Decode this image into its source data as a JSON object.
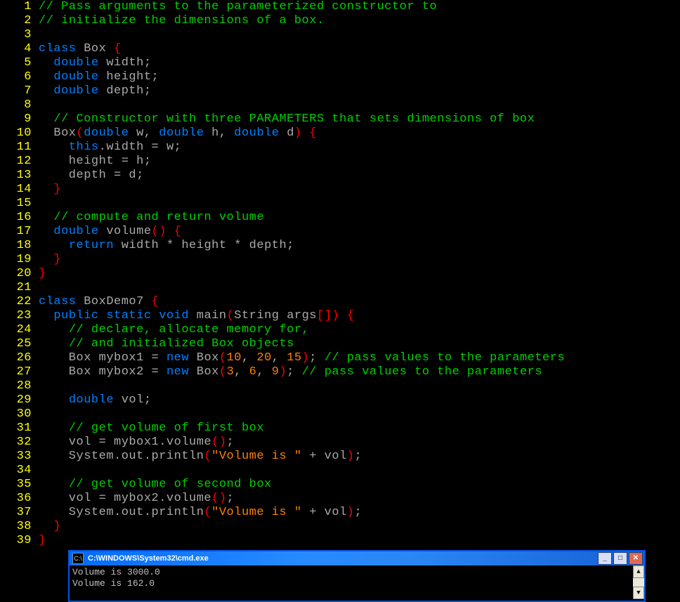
{
  "lines": [
    {
      "n": "1",
      "tokens": [
        {
          "c": "c",
          "t": "// Pass arguments to the parameterized constructor to"
        }
      ]
    },
    {
      "n": "2",
      "tokens": [
        {
          "c": "c",
          "t": "// initialize the dimensions of a box."
        }
      ]
    },
    {
      "n": "3",
      "tokens": []
    },
    {
      "n": "4",
      "tokens": [
        {
          "c": "kw",
          "t": "class"
        },
        {
          "c": "t",
          "t": " Box "
        },
        {
          "c": "br",
          "t": "{"
        }
      ]
    },
    {
      "n": "5",
      "tokens": [
        {
          "c": "t",
          "t": "  "
        },
        {
          "c": "kw",
          "t": "double"
        },
        {
          "c": "t",
          "t": " width;"
        }
      ]
    },
    {
      "n": "6",
      "tokens": [
        {
          "c": "t",
          "t": "  "
        },
        {
          "c": "kw",
          "t": "double"
        },
        {
          "c": "t",
          "t": " height;"
        }
      ]
    },
    {
      "n": "7",
      "tokens": [
        {
          "c": "t",
          "t": "  "
        },
        {
          "c": "kw",
          "t": "double"
        },
        {
          "c": "t",
          "t": " depth;"
        }
      ]
    },
    {
      "n": "8",
      "tokens": []
    },
    {
      "n": "9",
      "tokens": [
        {
          "c": "t",
          "t": "  "
        },
        {
          "c": "c",
          "t": "// Constructor with three PARAMETERS that sets dimensions of box"
        }
      ]
    },
    {
      "n": "10",
      "tokens": [
        {
          "c": "t",
          "t": "  Box"
        },
        {
          "c": "br",
          "t": "("
        },
        {
          "c": "kw",
          "t": "double"
        },
        {
          "c": "t",
          "t": " w, "
        },
        {
          "c": "kw",
          "t": "double"
        },
        {
          "c": "t",
          "t": " h, "
        },
        {
          "c": "kw",
          "t": "double"
        },
        {
          "c": "t",
          "t": " d"
        },
        {
          "c": "br",
          "t": ")"
        },
        {
          "c": "t",
          "t": " "
        },
        {
          "c": "br",
          "t": "{"
        }
      ]
    },
    {
      "n": "11",
      "tokens": [
        {
          "c": "t",
          "t": "    "
        },
        {
          "c": "kw",
          "t": "this"
        },
        {
          "c": "t",
          "t": ".width = w;"
        }
      ]
    },
    {
      "n": "12",
      "tokens": [
        {
          "c": "t",
          "t": "    height = h;"
        }
      ]
    },
    {
      "n": "13",
      "tokens": [
        {
          "c": "t",
          "t": "    depth = d;"
        }
      ]
    },
    {
      "n": "14",
      "tokens": [
        {
          "c": "t",
          "t": "  "
        },
        {
          "c": "br",
          "t": "}"
        }
      ]
    },
    {
      "n": "15",
      "tokens": []
    },
    {
      "n": "16",
      "tokens": [
        {
          "c": "t",
          "t": "  "
        },
        {
          "c": "c",
          "t": "// compute and return volume"
        }
      ]
    },
    {
      "n": "17",
      "tokens": [
        {
          "c": "t",
          "t": "  "
        },
        {
          "c": "kw",
          "t": "double"
        },
        {
          "c": "t",
          "t": " volume"
        },
        {
          "c": "br",
          "t": "()"
        },
        {
          "c": "t",
          "t": " "
        },
        {
          "c": "br",
          "t": "{"
        }
      ]
    },
    {
      "n": "18",
      "tokens": [
        {
          "c": "t",
          "t": "    "
        },
        {
          "c": "kw",
          "t": "return"
        },
        {
          "c": "t",
          "t": " width * height * depth;"
        }
      ]
    },
    {
      "n": "19",
      "tokens": [
        {
          "c": "t",
          "t": "  "
        },
        {
          "c": "br",
          "t": "}"
        }
      ]
    },
    {
      "n": "20",
      "tokens": [
        {
          "c": "br",
          "t": "}"
        }
      ]
    },
    {
      "n": "21",
      "tokens": []
    },
    {
      "n": "22",
      "tokens": [
        {
          "c": "kw",
          "t": "class"
        },
        {
          "c": "t",
          "t": " BoxDemo7 "
        },
        {
          "c": "br",
          "t": "{"
        }
      ]
    },
    {
      "n": "23",
      "tokens": [
        {
          "c": "t",
          "t": "  "
        },
        {
          "c": "kw",
          "t": "public"
        },
        {
          "c": "t",
          "t": " "
        },
        {
          "c": "kw",
          "t": "static"
        },
        {
          "c": "t",
          "t": " "
        },
        {
          "c": "kw",
          "t": "void"
        },
        {
          "c": "t",
          "t": " main"
        },
        {
          "c": "br",
          "t": "("
        },
        {
          "c": "t",
          "t": "String args"
        },
        {
          "c": "br",
          "t": "[])"
        },
        {
          "c": "t",
          "t": " "
        },
        {
          "c": "br",
          "t": "{"
        }
      ]
    },
    {
      "n": "24",
      "tokens": [
        {
          "c": "t",
          "t": "    "
        },
        {
          "c": "c",
          "t": "// declare, allocate memory for,"
        }
      ]
    },
    {
      "n": "25",
      "tokens": [
        {
          "c": "t",
          "t": "    "
        },
        {
          "c": "c",
          "t": "// and initialized Box objects"
        }
      ]
    },
    {
      "n": "26",
      "tokens": [
        {
          "c": "t",
          "t": "    Box mybox1 = "
        },
        {
          "c": "kw",
          "t": "new"
        },
        {
          "c": "t",
          "t": " Box"
        },
        {
          "c": "br",
          "t": "("
        },
        {
          "c": "nu",
          "t": "10"
        },
        {
          "c": "t",
          "t": ", "
        },
        {
          "c": "nu",
          "t": "20"
        },
        {
          "c": "t",
          "t": ", "
        },
        {
          "c": "nu",
          "t": "15"
        },
        {
          "c": "br",
          "t": ")"
        },
        {
          "c": "t",
          "t": "; "
        },
        {
          "c": "c",
          "t": "// pass values to the parameters"
        }
      ]
    },
    {
      "n": "27",
      "tokens": [
        {
          "c": "t",
          "t": "    Box mybox2 = "
        },
        {
          "c": "kw",
          "t": "new"
        },
        {
          "c": "t",
          "t": " Box"
        },
        {
          "c": "br",
          "t": "("
        },
        {
          "c": "nu",
          "t": "3"
        },
        {
          "c": "t",
          "t": ", "
        },
        {
          "c": "nu",
          "t": "6"
        },
        {
          "c": "t",
          "t": ", "
        },
        {
          "c": "nu",
          "t": "9"
        },
        {
          "c": "br",
          "t": ")"
        },
        {
          "c": "t",
          "t": "; "
        },
        {
          "c": "c",
          "t": "// pass values to the parameters"
        }
      ]
    },
    {
      "n": "28",
      "tokens": []
    },
    {
      "n": "29",
      "tokens": [
        {
          "c": "t",
          "t": "    "
        },
        {
          "c": "kw",
          "t": "double"
        },
        {
          "c": "t",
          "t": " vol;"
        }
      ]
    },
    {
      "n": "30",
      "tokens": []
    },
    {
      "n": "31",
      "tokens": [
        {
          "c": "t",
          "t": "    "
        },
        {
          "c": "c",
          "t": "// get volume of first box"
        }
      ]
    },
    {
      "n": "32",
      "tokens": [
        {
          "c": "t",
          "t": "    vol = mybox1.volume"
        },
        {
          "c": "br",
          "t": "()"
        },
        {
          "c": "t",
          "t": ";"
        }
      ]
    },
    {
      "n": "33",
      "tokens": [
        {
          "c": "t",
          "t": "    System.out.println"
        },
        {
          "c": "br",
          "t": "("
        },
        {
          "c": "st",
          "t": "\"Volume is \""
        },
        {
          "c": "t",
          "t": " + vol"
        },
        {
          "c": "br",
          "t": ")"
        },
        {
          "c": "t",
          "t": ";"
        }
      ]
    },
    {
      "n": "34",
      "tokens": []
    },
    {
      "n": "35",
      "tokens": [
        {
          "c": "t",
          "t": "    "
        },
        {
          "c": "c",
          "t": "// get volume of second box"
        }
      ]
    },
    {
      "n": "36",
      "tokens": [
        {
          "c": "t",
          "t": "    vol = mybox2.volume"
        },
        {
          "c": "br",
          "t": "()"
        },
        {
          "c": "t",
          "t": ";"
        }
      ]
    },
    {
      "n": "37",
      "tokens": [
        {
          "c": "t",
          "t": "    System.out.println"
        },
        {
          "c": "br",
          "t": "("
        },
        {
          "c": "st",
          "t": "\"Volume is \""
        },
        {
          "c": "t",
          "t": " + vol"
        },
        {
          "c": "br",
          "t": ")"
        },
        {
          "c": "t",
          "t": ";"
        }
      ]
    },
    {
      "n": "38",
      "tokens": [
        {
          "c": "t",
          "t": "  "
        },
        {
          "c": "br",
          "t": "}"
        }
      ]
    },
    {
      "n": "39",
      "tokens": [
        {
          "c": "br",
          "t": "}"
        }
      ]
    }
  ],
  "cmd": {
    "icon_text": "C:\\",
    "title": "C:\\WINDOWS\\System32\\cmd.exe",
    "output_lines": [
      "Volume is 3000.0",
      "Volume is 162.0"
    ],
    "min_label": "_",
    "max_label": "□",
    "close_label": "✕",
    "scroll_up": "▲",
    "scroll_down": "▼"
  }
}
